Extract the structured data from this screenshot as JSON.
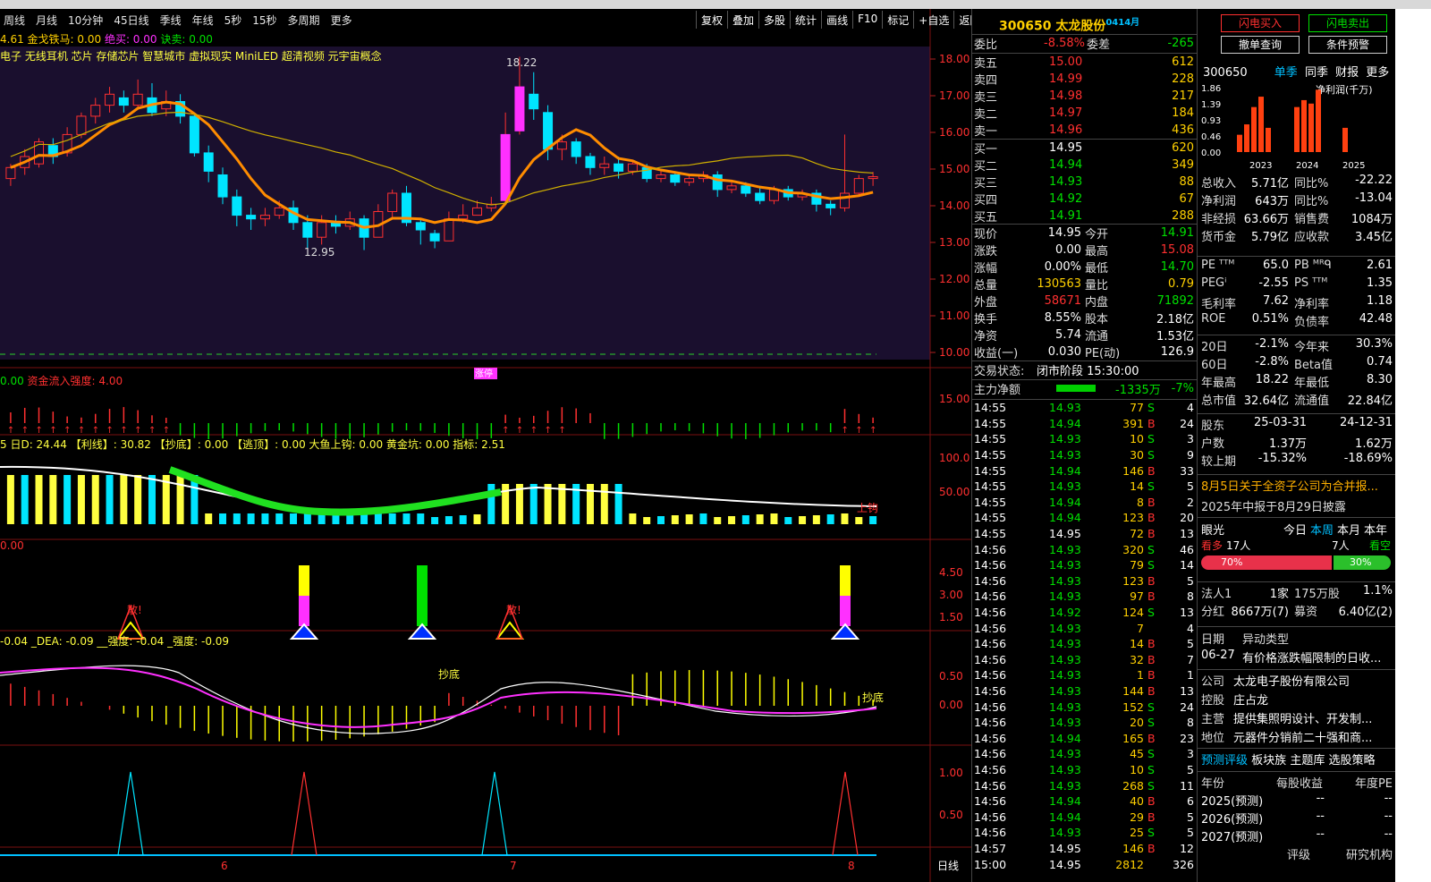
{
  "periods": [
    "周线",
    "月线",
    "10分钟",
    "45日线",
    "季线",
    "年线",
    "5秒",
    "15秒",
    "多周期",
    "更多"
  ],
  "tools": [
    "复权",
    "叠加",
    "多股",
    "统计",
    "画线",
    "F10",
    "标记",
    "+自选",
    "返回"
  ],
  "main_indicator": {
    "v1": "4.61",
    "label": "金戈铁马: 0.00",
    "sell": "绝买: 0.00",
    "buy": "诀卖: 0.00"
  },
  "concepts": "电子 无线耳机 芯片 存储芯片 智慧城市 虚拟现实 MiniLED 超清视频 元宇宙概念",
  "price_axis": [
    "18.00",
    "17.00",
    "16.00",
    "15.00",
    "14.00",
    "13.00",
    "12.00",
    "11.00",
    "10.00"
  ],
  "high_label": "18.22",
  "low_label": "12.95",
  "bottom_tag": "涨停",
  "panel2": {
    "a": "0.00",
    "label": "资金流入强度: 4.00",
    "axis": "15.00"
  },
  "panel3": {
    "text": "5 日D: 24.44 【利线】: 30.82 【抄底】: 0.00 【逃顶】: 0.00 大鱼上钩: 0.00 黄金坑: 0.00 指标: 2.51",
    "axis": [
      "100.0",
      "50.00"
    ],
    "tag": "上钩"
  },
  "panel4": {
    "a": "0.00",
    "axis": [
      "4.50",
      "3.00",
      "1.50"
    ],
    "tag": "散!"
  },
  "panel5": {
    "text": "-0.04 _DEA: -0.09 __强度: -0.04 _强度: -0.09",
    "axis": [
      "0.50",
      "0.00"
    ],
    "tag": "抄底"
  },
  "panel6": {
    "axis": [
      "1.00",
      "0.50"
    ]
  },
  "x_labels": [
    "6",
    "7",
    "8"
  ],
  "x_right": "日线",
  "stock": {
    "code": "300650",
    "name": "太龙股份",
    "tag": "0414月"
  },
  "weibi": {
    "label": "委比",
    "val": "-8.58%",
    "label2": "委差",
    "val2": "-265"
  },
  "sells": [
    {
      "n": "卖五",
      "p": "15.00",
      "v": "612"
    },
    {
      "n": "卖四",
      "p": "14.99",
      "v": "228"
    },
    {
      "n": "卖三",
      "p": "14.98",
      "v": "217"
    },
    {
      "n": "卖二",
      "p": "14.97",
      "v": "184"
    },
    {
      "n": "卖一",
      "p": "14.96",
      "v": "436"
    }
  ],
  "buys": [
    {
      "n": "买一",
      "p": "14.95",
      "v": "620"
    },
    {
      "n": "买二",
      "p": "14.94",
      "v": "349"
    },
    {
      "n": "买三",
      "p": "14.93",
      "v": "88"
    },
    {
      "n": "买四",
      "p": "14.92",
      "v": "67"
    },
    {
      "n": "买五",
      "p": "14.91",
      "v": "288"
    }
  ],
  "quote": [
    {
      "a": "现价",
      "b": "14.95",
      "c": "今开",
      "d": "14.91"
    },
    {
      "a": "涨跌",
      "b": "0.00",
      "c": "最高",
      "d": "15.08"
    },
    {
      "a": "涨幅",
      "b": "0.00%",
      "c": "最低",
      "d": "14.70"
    },
    {
      "a": "总量",
      "b": "130563",
      "c": "量比",
      "d": "0.79"
    },
    {
      "a": "外盘",
      "b": "58671",
      "c": "内盘",
      "d": "71892"
    },
    {
      "a": "换手",
      "b": "8.55%",
      "c": "股本",
      "d": "2.18亿"
    },
    {
      "a": "净资",
      "b": "5.74",
      "c": "流通",
      "d": "1.53亿"
    },
    {
      "a": "收益(一)",
      "b": "0.030",
      "c": "PE(动)",
      "d": "126.9"
    }
  ],
  "status": {
    "label": "交易状态:",
    "val": "闭市阶段 15:30:00"
  },
  "flow": {
    "label": "主力净额",
    "val": "-1335万",
    "pct": "-7%"
  },
  "ticks": [
    [
      "14:55",
      "14.93",
      "77",
      "S",
      "4"
    ],
    [
      "14:55",
      "14.94",
      "391",
      "B",
      "24"
    ],
    [
      "14:55",
      "14.93",
      "10",
      "S",
      "3"
    ],
    [
      "14:55",
      "14.93",
      "30",
      "S",
      "9"
    ],
    [
      "14:55",
      "14.94",
      "146",
      "B",
      "33"
    ],
    [
      "14:55",
      "14.93",
      "14",
      "S",
      "5"
    ],
    [
      "14:55",
      "14.94",
      "8",
      "B",
      "2"
    ],
    [
      "14:55",
      "14.94",
      "123",
      "B",
      "20"
    ],
    [
      "14:55",
      "14.95",
      "72",
      "B",
      "13"
    ],
    [
      "14:56",
      "14.93",
      "320",
      "S",
      "46"
    ],
    [
      "14:56",
      "14.93",
      "79",
      "S",
      "14"
    ],
    [
      "14:56",
      "14.93",
      "123",
      "B",
      "5"
    ],
    [
      "14:56",
      "14.93",
      "97",
      "B",
      "8"
    ],
    [
      "14:56",
      "14.92",
      "124",
      "S",
      "13"
    ],
    [
      "14:56",
      "14.93",
      "7",
      "",
      "4"
    ],
    [
      "14:56",
      "14.93",
      "14",
      "B",
      "5"
    ],
    [
      "14:56",
      "14.93",
      "32",
      "B",
      "7"
    ],
    [
      "14:56",
      "14.93",
      "1",
      "B",
      "1"
    ],
    [
      "14:56",
      "14.93",
      "144",
      "B",
      "13"
    ],
    [
      "14:56",
      "14.93",
      "152",
      "S",
      "24"
    ],
    [
      "14:56",
      "14.93",
      "20",
      "S",
      "8"
    ],
    [
      "14:56",
      "14.94",
      "165",
      "B",
      "23"
    ],
    [
      "14:56",
      "14.93",
      "45",
      "S",
      "3"
    ],
    [
      "14:56",
      "14.93",
      "10",
      "S",
      "5"
    ],
    [
      "14:56",
      "14.93",
      "268",
      "S",
      "11"
    ],
    [
      "14:56",
      "14.94",
      "40",
      "B",
      "6"
    ],
    [
      "14:56",
      "14.94",
      "29",
      "B",
      "5"
    ],
    [
      "14:56",
      "14.93",
      "25",
      "S",
      "5"
    ],
    [
      "14:57",
      "14.95",
      "146",
      "B",
      "12"
    ],
    [
      "15:00",
      "14.95",
      "2812",
      "",
      "326"
    ]
  ],
  "btns": [
    "闪电买入",
    "闪电卖出",
    "撤单查询",
    "条件预警"
  ],
  "fin_head": {
    "code": "300650",
    "tabs": [
      "单季",
      "同季",
      "财报",
      "更多"
    ],
    "axis": [
      "1.86",
      "1.39",
      "0.93",
      "0.46",
      "0.00"
    ],
    "years": [
      "2023",
      "2024",
      "2025"
    ],
    "title": "净利润(千万)",
    "bars": [
      0.5,
      0.8,
      1.3,
      1.6,
      0.7,
      1.3,
      1.5,
      1.4,
      1.8,
      0.7
    ]
  },
  "fin": [
    {
      "a": "总收入",
      "b": "5.71亿",
      "c": "同比%",
      "d": "-22.22"
    },
    {
      "a": "净利润",
      "b": "643万",
      "c": "同比%",
      "d": "-13.04"
    },
    {
      "a": "非经损",
      "b": "63.66万",
      "c": "销售费",
      "d": "1084万"
    },
    {
      "a": "货币金",
      "b": "5.79亿",
      "c": "应收款",
      "d": "3.45亿"
    }
  ],
  "val": [
    {
      "a": "PE ᵀᵀᴹ",
      "b": "65.0",
      "c": "PB ᴹᴿᑫ",
      "d": "2.61"
    },
    {
      "a": "PEGⁱ",
      "b": "-2.55",
      "c": "PS ᵀᵀᴹ",
      "d": "1.35"
    },
    {
      "a": "毛利率",
      "b": "7.62",
      "c": "净利率",
      "d": "1.18"
    },
    {
      "a": "ROE",
      "b": "0.51%",
      "c": "负债率",
      "d": "42.48"
    }
  ],
  "perf": [
    {
      "a": "20日",
      "b": "-2.1%",
      "c": "今年来",
      "d": "30.3%"
    },
    {
      "a": "60日",
      "b": "-2.8%",
      "c": "Beta值",
      "d": "0.74"
    },
    {
      "a": "年最高",
      "b": "18.22",
      "c": "年最低",
      "d": "8.30"
    },
    {
      "a": "总市值",
      "b": "32.64亿",
      "c": "流通值",
      "d": "22.84亿"
    }
  ],
  "holders": [
    {
      "a": "股东",
      "b": "25-03-31",
      "c": "24-12-31"
    },
    {
      "a": "户数",
      "b": "1.37万",
      "c": "1.62万"
    },
    {
      "a": "较上期",
      "b": "-15.32%",
      "c": "-18.69%"
    }
  ],
  "news": [
    "8月5日关于全资子公司为合并报...",
    "2025年中报于8月29日披露"
  ],
  "eye": {
    "label": "眼光",
    "tabs": [
      "今日",
      "本周",
      "本月",
      "本年"
    ],
    "bear": "看多",
    "bear_n": "17人",
    "bull_n": "7人",
    "bull": "看空",
    "pct_a": "70%",
    "pct_b": "30%"
  },
  "inst": [
    {
      "a": "法人1",
      "b": "1家",
      "c": "175万股",
      "d": "1.1%"
    },
    {
      "a": "分红",
      "b": "8667万(7)",
      "c": "募资",
      "d": "6.40亿(2)"
    }
  ],
  "events": {
    "h1": "日期",
    "h2": "异动类型",
    "d": "06-27",
    "t": "有价格涨跌幅限制的日收..."
  },
  "company": [
    {
      "a": "公司",
      "b": "太龙电子股份有限公司"
    },
    {
      "a": "控股",
      "b": "庄占龙"
    },
    {
      "a": "主营",
      "b": "提供集照明设计、开发制..."
    },
    {
      "a": "地位",
      "b": "元器件分销前二十强和商..."
    }
  ],
  "tabs2": [
    "预测评级",
    "板块族",
    "主题库",
    "选股策略"
  ],
  "forecast": {
    "h": [
      "年份",
      "每股收益",
      "年度PE"
    ],
    "rows": [
      [
        "2025(预测)",
        "--",
        "--"
      ],
      [
        "2026(预测)",
        "--",
        "--"
      ],
      [
        "2027(预测)",
        "--",
        "--"
      ]
    ],
    "foot": [
      "评级",
      "研究机构"
    ]
  },
  "colors": {
    "up": "#ff3030",
    "down": "#00e5ff",
    "ma": "#ff8c00",
    "bg": "#1a0f2e"
  }
}
